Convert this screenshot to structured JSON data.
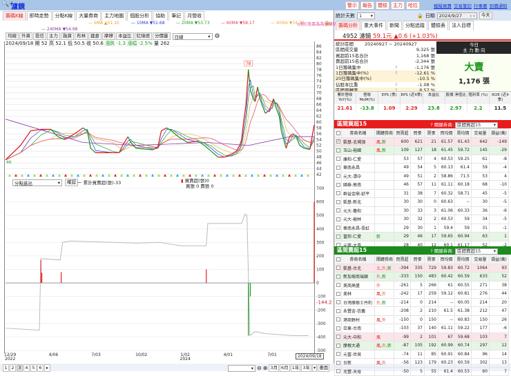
{
  "app": {
    "title": "濾鏡",
    "search_icon": "magnifier-plus-icon"
  },
  "top_buttons": [
    "警示",
    "報告",
    "體檢",
    "主力",
    "哈拉"
  ],
  "top_links": [
    "模擬買賣",
    "交易筆記",
    "行事曆",
    "到價通知"
  ],
  "tabs": [
    {
      "label": "籌碼K線",
      "active": true
    },
    {
      "label": "即時走勢"
    },
    {
      "label": "分點K線"
    },
    {
      "label": "大量券商"
    },
    {
      "label": "主力地圖"
    },
    {
      "label": "個股分析"
    },
    {
      "label": "協助"
    },
    {
      "label": "筆記"
    },
    {
      "label": "月營收"
    }
  ],
  "ma_legend": [
    {
      "label": "5MA ▲51.10",
      "color": "#e0a020"
    },
    {
      "label": "10MA ▼51.68",
      "color": "#2a3bd8"
    },
    {
      "label": "20MA ▼53.73",
      "color": "#2a9a2a"
    },
    {
      "label": "60MA ▼58.17",
      "color": "#e23a5a"
    },
    {
      "label": "40MA ▼54.73",
      "color": "#e8b040"
    },
    {
      "label": "240MA ▼54.98",
      "color": "#8a3aa8"
    }
  ],
  "ma_note": "◎對C色區為為量離點",
  "toolbar": {
    "buttons": [
      "均線",
      "外資",
      "投信",
      "主力",
      "融資",
      "布林",
      "建倉",
      "摩擦",
      "本益比",
      "紅綠燈",
      "分價量"
    ],
    "period": "日線",
    "settings_icon": "gear-icon"
  },
  "info_line": {
    "date": "2024/09/18",
    "open": "開 52",
    "high": "高 52.1",
    "low": "低 50.5",
    "close": "收 50.6",
    "change": "漲跌 -1.3",
    "pct": "漲幅 -2.5%",
    "volume": "量 262"
  },
  "price_chart": {
    "y_ticks": [
      86,
      84,
      82,
      80,
      78,
      76,
      74,
      72,
      70,
      68,
      66,
      64,
      62,
      60,
      58,
      56,
      54,
      52,
      50,
      48,
      46,
      44,
      42
    ],
    "ylim": [
      42,
      86
    ],
    "max_label": "78",
    "min_label": "46",
    "closes": [
      [
        "2022-12-29",
        47
      ],
      [
        "2023-01-29",
        52
      ],
      [
        "2023-02-19",
        57
      ],
      [
        "2023-03-12",
        57.5
      ],
      [
        "2023-04-02",
        57.5
      ],
      [
        "2023-04-16",
        55
      ],
      [
        "2023-04-30",
        54
      ],
      [
        "2023-05-21",
        56
      ],
      [
        "2023-06-07",
        58
      ],
      [
        "2023-06-16",
        57
      ],
      [
        "2023-06-23",
        51
      ],
      [
        "2023-07-03",
        49.5
      ],
      [
        "2023-08-07",
        49.5
      ],
      [
        "2023-08-21",
        49.5
      ],
      [
        "2023-08-28",
        52
      ],
      [
        "2023-09-08",
        55
      ],
      [
        "2023-09-14",
        53
      ],
      [
        "2023-09-25",
        51
      ],
      [
        "2023-10-30",
        50.5
      ],
      [
        "2023-11-09",
        51.5
      ],
      [
        "2023-11-16",
        57
      ],
      [
        "2023-11-27",
        58
      ],
      [
        "2023-12-07",
        57
      ],
      [
        "2023-12-21",
        55
      ],
      [
        "2024-01-09",
        53
      ],
      [
        "2024-01-30",
        53.5
      ],
      [
        "2024-02-13",
        52
      ],
      [
        "2024-02-27",
        50
      ],
      [
        "2024-03-12",
        48
      ],
      [
        "2024-03-26",
        48
      ],
      [
        "2024-04-09",
        49
      ],
      [
        "2024-04-19",
        50
      ],
      [
        "2024-04-26",
        52
      ],
      [
        "2024-04-30",
        54
      ],
      [
        "2024-05-04",
        60
      ],
      [
        "2024-05-09",
        66
      ],
      [
        "2024-05-14",
        78
      ],
      [
        "2024-05-18",
        71
      ],
      [
        "2024-05-24",
        68
      ],
      [
        "2024-05-28",
        67
      ],
      [
        "2024-06-02",
        72
      ],
      [
        "2024-06-07",
        68
      ],
      [
        "2024-06-11",
        66
      ],
      [
        "2024-06-18",
        63
      ],
      [
        "2024-06-26",
        64
      ],
      [
        "2024-07-03",
        67
      ],
      [
        "2024-07-05",
        68
      ],
      [
        "2024-07-12",
        64
      ],
      [
        "2024-07-17",
        62
      ],
      [
        "2024-07-21",
        57
      ],
      [
        "2024-07-26",
        54
      ],
      [
        "2024-07-31",
        51
      ],
      [
        "2024-08-07",
        55
      ],
      [
        "2024-08-14",
        56
      ],
      [
        "2024-08-21",
        55
      ],
      [
        "2024-08-28",
        52
      ],
      [
        "2024-09-06",
        51
      ],
      [
        "2024-09-18",
        50.6
      ],
      [
        "2024-09-27",
        59
      ]
    ],
    "colors": {
      "up": "#e02020",
      "down": "#1a9a1a"
    }
  },
  "lower_chart": {
    "selector": "分點進出",
    "confirm": "確認",
    "legend_line": "一 累計買賣超(張)-33",
    "legend_bar": "買賣超(張)0",
    "legend_bar2": "買張 0 賣張 0",
    "y_ticks": [
      700,
      600,
      500,
      400,
      300,
      200,
      100,
      0,
      -100,
      -200,
      -300,
      -400,
      -500
    ],
    "ylim": [
      -500,
      700
    ],
    "current_label": "-144.2",
    "cumulative": [
      [
        "2022-12-29",
        -335
      ],
      [
        "2023-03-09",
        -350
      ],
      [
        "2023-03-12",
        180
      ],
      [
        "2023-04-21",
        170
      ],
      [
        "2023-04-26",
        300
      ],
      [
        "2023-05-12",
        310
      ],
      [
        "2023-09-25",
        295
      ],
      [
        "2023-11-13",
        300
      ],
      [
        "2023-12-26",
        275
      ],
      [
        "2024-02-17",
        275
      ],
      [
        "2024-02-20",
        440
      ],
      [
        "2024-04-30",
        440
      ],
      [
        "2024-05-07",
        510
      ],
      [
        "2024-05-11",
        500
      ],
      [
        "2024-05-17",
        -390
      ],
      [
        "2024-05-28",
        -360
      ],
      [
        "2024-06-18",
        -375
      ],
      [
        "2024-08-14",
        -390
      ],
      [
        "2024-09-15",
        -390
      ]
    ],
    "bars": [
      [
        "2023-03-12",
        170
      ],
      [
        "2023-03-14",
        75
      ],
      [
        "2023-04-23",
        80
      ],
      [
        "2024-02-17",
        100
      ],
      [
        "2024-05-14",
        -390
      ],
      [
        "2024-05-18",
        -100
      ],
      [
        "2024-09-27",
        600
      ]
    ]
  },
  "x_axis": {
    "ticks": [
      [
        "2022-12-29",
        "12/29",
        "2022"
      ],
      [
        "2023-04-06",
        "4/06",
        ""
      ],
      [
        "2023-07-03",
        "7/03",
        ""
      ],
      [
        "2023-10-02",
        "10/02",
        ""
      ],
      [
        "2024-01-02",
        "1/02",
        "2024"
      ],
      [
        "2024-04-01",
        "4/01",
        ""
      ],
      [
        "2024-07-01",
        "7/01",
        ""
      ]
    ],
    "cursor": "2024/09/18",
    "start": "2022-12-29",
    "end": "2024-09-27"
  },
  "bottom": {
    "pages": [
      "1",
      "2",
      "3",
      "4",
      "5",
      "6",
      "▸"
    ],
    "active_page": "3",
    "ranges": [
      "3月",
      "6月",
      "1年",
      "3年",
      "▾",
      "畫面"
    ],
    "zoom_out_icon": "zoom-out-icon",
    "zoom_in_icon": "zoom-in-icon"
  },
  "right": {
    "days_label": "統計天數",
    "days_value": "1",
    "date_label": "日期",
    "date_value": "2024/9/27",
    "today_btn": "今天",
    "tabs": [
      {
        "label": "籌碼分析",
        "active": true
      },
      {
        "label": "重大事件"
      },
      {
        "label": "新聞"
      },
      {
        "label": "分點追蹤"
      },
      {
        "label": "體檢表"
      },
      {
        "label": "法人目標"
      }
    ],
    "stock": {
      "code_name": "4952 濾鏡",
      "price": "59.1元",
      "change": "▲0.6 (+1.03%)"
    },
    "stats": [
      {
        "label": "統計區間",
        "value": "20240927 ~ 20240927"
      },
      {
        "label": "區間成交量",
        "value": "9,325 張"
      },
      {
        "label": "買超前15名合計",
        "value": "1,168 張"
      },
      {
        "label": "賣超前15名合計",
        "value": "-2,344 張"
      },
      {
        "label": "1日籌碼集中",
        "value": "-1,176 張",
        "q": "?"
      },
      {
        "label": "1日籌碼集中(%)",
        "value": "-12.61 %",
        "q": "?",
        "hl": true
      },
      {
        "label": "20日籌碼集中(%)",
        "value": "-10.5 %",
        "hl": true
      },
      {
        "label": "佔股本比重",
        "value": "-1.08 %",
        "q": "?"
      },
      {
        "label": "區間周轉率",
        "value": "8.57 %",
        "q": "?",
        "hl": true
      }
    ],
    "today": {
      "title1": "今日",
      "title2": "主 力 動 向",
      "verdict": "大賣",
      "qty": "1,176 張"
    },
    "fin": [
      {
        "h": "累計營收 YoY(%)",
        "v": "21.61",
        "c": "up"
      },
      {
        "h": "營收 MoM(%)",
        "v": "-13.8",
        "c": "dn"
      },
      {
        "h": "EPS (季)",
        "v": "1.09",
        "c": "up"
      },
      {
        "h": "EPS (近4季)",
        "v": "2.29",
        "c": "up"
      },
      {
        "h": "本益比",
        "v": "23.8",
        "c": "dn"
      },
      {
        "h": "股價 淨值比",
        "v": "2.97",
        "c": "dn"
      },
      {
        "h": "殖利率 (%)",
        "v": "2.2",
        "c": "dn"
      },
      {
        "h": "ROE (近4季)",
        "v": "11.5",
        "c": ""
      }
    ],
    "columns": [
      "",
      "券商名稱",
      "關鍵券商",
      "買賣超",
      "買張",
      "賣張",
      "買均價",
      "賣均價",
      "交易量",
      "損益(萬)"
    ],
    "buy_table": {
      "title": "區間買超15",
      "key_label": "? 關鍵券商:",
      "key_value": "區間買超15",
      "color": "#e81c1c",
      "rows": [
        {
          "name": "凱基-北埔頂",
          "tags": "風,新",
          "v": [
            "600",
            "621",
            "21",
            "61.57",
            "61.43",
            "642",
            "-149"
          ],
          "style": "pink",
          "checked": true
        },
        {
          "name": "玉山-裕國",
          "tags": "風,新",
          "v": [
            "109",
            "127",
            "18",
            "61.45",
            "59.72",
            "145",
            "-29"
          ],
          "style": "green"
        },
        {
          "name": "康和-仁愛",
          "tags": "",
          "v": [
            "53",
            "57",
            "4",
            "60.53",
            "59.25",
            "61",
            "-8"
          ]
        },
        {
          "name": "華南永昌",
          "tags": "",
          "v": [
            "49",
            "54",
            "5",
            "60.13",
            "61.4",
            "59",
            "-4"
          ]
        },
        {
          "name": "元大-潭中",
          "tags": "",
          "v": [
            "49",
            "51",
            "2",
            "58.86",
            "71.5",
            "53",
            "4"
          ]
        },
        {
          "name": "國泰-敦南",
          "tags": "",
          "v": [
            "46",
            "57",
            "11",
            "61.11",
            "60.18",
            "68",
            "-10"
          ]
        },
        {
          "name": "群益金鼎-延平",
          "tags": "",
          "v": [
            "31",
            "38",
            "7",
            "60.32",
            "58.71",
            "45",
            "-5"
          ]
        },
        {
          "name": "凱基-新北",
          "tags": "",
          "v": [
            "30",
            "30",
            "0",
            "60.63",
            "--",
            "30",
            "-5"
          ]
        },
        {
          "name": "元大-雙和",
          "tags": "",
          "v": [
            "30",
            "33",
            "3",
            "61.06",
            "60.33",
            "36",
            "-6"
          ]
        },
        {
          "name": "元大-樹林",
          "tags": "",
          "v": [
            "30",
            "32",
            "2",
            "60.53",
            "59",
            "34",
            "-5"
          ]
        },
        {
          "name": "華南永昌-長虹",
          "tags": "",
          "v": [
            "29",
            "30",
            "1",
            "59.4",
            "59",
            "31",
            "-1"
          ]
        },
        {
          "name": "富邦-仁愛",
          "tags": "新",
          "v": [
            "29",
            "46",
            "17",
            "59.65",
            "60.94",
            "63",
            "1"
          ],
          "style": "green"
        },
        {
          "name": "元富-大昌",
          "tags": "",
          "v": [
            "28",
            "40",
            "12",
            "60.1",
            "61.17",
            "52",
            "-2"
          ]
        }
      ]
    },
    "sell_table": {
      "title": "區間賣超15",
      "key_label": "? 關鍵券商:",
      "key_value": "區間賣超15",
      "color": "#1c8a1c",
      "rows": [
        {
          "name": "凱基-台北",
          "tags": "土,外,新",
          "v": [
            "-394",
            "335",
            "729",
            "59.83",
            "60.72",
            "1064",
            "93"
          ],
          "style": "pink"
        },
        {
          "name": "新加坡商瑞銀",
          "tags": "外,新",
          "v": [
            "-333",
            "150",
            "483",
            "60.42",
            "60.59",
            "633",
            "52"
          ],
          "style": "green"
        },
        {
          "name": "美商高盛",
          "tags": "外",
          "v": [
            "-261",
            "5",
            "266",
            "61",
            "60.55",
            "271",
            "38"
          ]
        },
        {
          "name": "美林",
          "tags": "風,外",
          "v": [
            "-242",
            "17",
            "259",
            "59.12",
            "60.81",
            "276",
            "44"
          ]
        },
        {
          "name": "台灣摩根士丹利",
          "tags": "外,新",
          "v": [
            "-214",
            "0",
            "214",
            "--",
            "60.05",
            "214",
            "20"
          ]
        },
        {
          "name": "永豐金-信義",
          "tags": "",
          "v": [
            "-208",
            "2",
            "210",
            "61.5",
            "61.38",
            "212",
            "47"
          ]
        },
        {
          "name": "港商野村",
          "tags": "風,外",
          "v": [
            "-150",
            "0",
            "150",
            "--",
            "60.83",
            "150",
            "26"
          ]
        },
        {
          "name": "亞東-台南",
          "tags": "",
          "v": [
            "-103",
            "37",
            "140",
            "61.11",
            "59.22",
            "177",
            "-6"
          ]
        },
        {
          "name": "元大-中和",
          "tags": "風",
          "v": [
            "-99",
            "2",
            "101",
            "67",
            "59.68",
            "103",
            "7"
          ],
          "style": "pink"
        },
        {
          "name": "摩根大通",
          "tags": "風,外,新",
          "v": [
            "-87",
            "105",
            "192",
            "60.99",
            "60.74",
            "297",
            "12"
          ],
          "style": "green"
        },
        {
          "name": "元富-世貿",
          "tags": "",
          "v": [
            "-74",
            "11",
            "85",
            "60.91",
            "60.84",
            "96",
            "14"
          ]
        },
        {
          "name": "台新",
          "tags": "風,外",
          "v": [
            "-56",
            "123",
            "179",
            "60.23",
            "60.59",
            "302",
            "13"
          ]
        },
        {
          "name": "兆豐-天母",
          "tags": "",
          "v": [
            "-50",
            "5",
            "55",
            "61.4",
            "60.53",
            "60",
            "7"
          ]
        }
      ]
    }
  }
}
